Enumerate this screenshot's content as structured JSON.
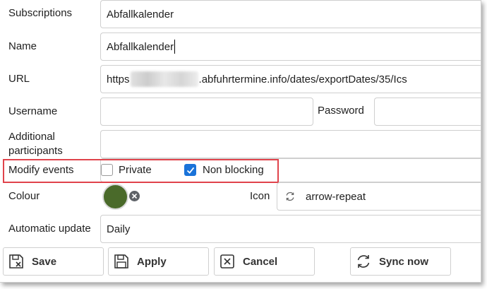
{
  "form": {
    "subscriptions": {
      "label": "Subscriptions",
      "value": "Abfallkalender"
    },
    "name": {
      "label": "Name",
      "value": "Abfallkalender"
    },
    "url": {
      "label": "URL",
      "prefix": "https",
      "suffix": ".abfuhrtermine.info/dates/exportDates/35/Ics"
    },
    "username": {
      "label": "Username",
      "value": ""
    },
    "password": {
      "label": "Password",
      "value": ""
    },
    "participants": {
      "label_line1": "Additional",
      "label_line2": "participants",
      "value": ""
    },
    "modify_events": {
      "label": "Modify events",
      "private": {
        "label": "Private",
        "checked": false
      },
      "non_blocking": {
        "label": "Non blocking",
        "checked": true
      }
    },
    "colour": {
      "label": "Colour",
      "value": "#4a6a2a"
    },
    "icon": {
      "label": "Icon",
      "value": "arrow-repeat",
      "icon_name": "arrow-repeat-icon"
    },
    "automatic_update": {
      "label": "Automatic update",
      "value": "Daily"
    }
  },
  "buttons": {
    "save": "Save",
    "apply": "Apply",
    "cancel": "Cancel",
    "sync": "Sync now"
  },
  "colors": {
    "highlight": "#e0434b",
    "checkbox_checked": "#1a73d9"
  }
}
